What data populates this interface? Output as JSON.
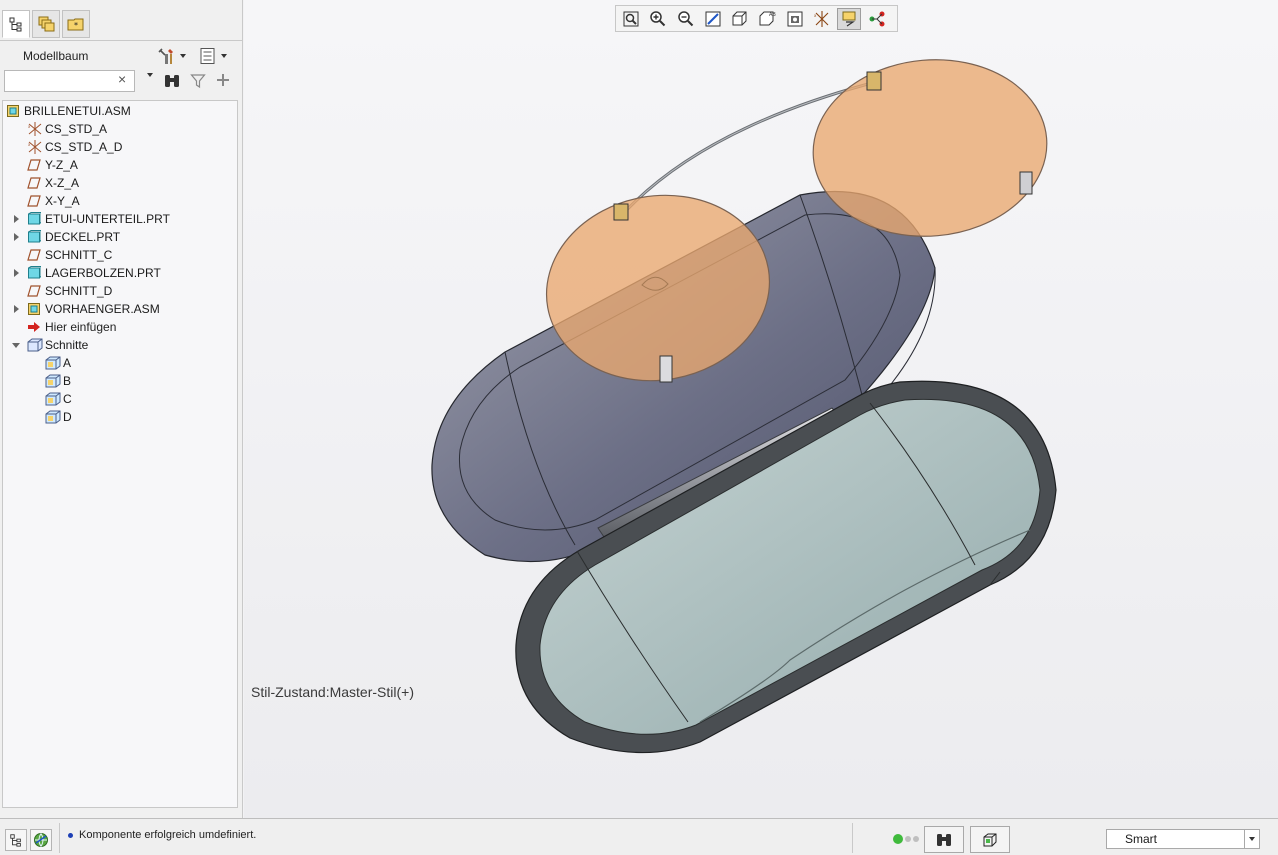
{
  "left_panel": {
    "tabs": [
      "model-tree-icon",
      "layers-icon",
      "favorites-folder-icon"
    ],
    "tree_title": "Modellbaum",
    "search": {
      "value": "",
      "placeholder": ""
    },
    "tree": [
      {
        "label": "BRILLENETUI.ASM",
        "icon": "assembly-icon",
        "depth": 0,
        "expand": "none"
      },
      {
        "label": "CS_STD_A",
        "icon": "coordinate-system-icon",
        "depth": 1,
        "expand": "none"
      },
      {
        "label": "CS_STD_A_D",
        "icon": "coordinate-system-icon",
        "depth": 1,
        "expand": "none"
      },
      {
        "label": "Y-Z_A",
        "icon": "datum-plane-icon",
        "depth": 1,
        "expand": "none"
      },
      {
        "label": "X-Z_A",
        "icon": "datum-plane-icon",
        "depth": 1,
        "expand": "none"
      },
      {
        "label": "X-Y_A",
        "icon": "datum-plane-icon",
        "depth": 1,
        "expand": "none"
      },
      {
        "label": "ETUI-UNTERTEIL.PRT",
        "icon": "part-icon",
        "depth": 1,
        "expand": "collapsed"
      },
      {
        "label": "DECKEL.PRT",
        "icon": "part-icon",
        "depth": 1,
        "expand": "collapsed"
      },
      {
        "label": "SCHNITT_C",
        "icon": "datum-plane-icon",
        "depth": 1,
        "expand": "none"
      },
      {
        "label": "LAGERBOLZEN.PRT",
        "icon": "part-icon",
        "depth": 1,
        "expand": "collapsed"
      },
      {
        "label": "SCHNITT_D",
        "icon": "datum-plane-icon",
        "depth": 1,
        "expand": "none"
      },
      {
        "label": "VORHAENGER.ASM",
        "icon": "assembly-icon",
        "depth": 1,
        "expand": "collapsed"
      },
      {
        "label": "Hier einfügen",
        "icon": "insert-here-arrow-icon",
        "depth": 1,
        "expand": "none"
      },
      {
        "label": "Schnitte",
        "icon": "sections-folder-icon",
        "depth": 1,
        "expand": "expanded"
      },
      {
        "label": "A",
        "icon": "section-icon",
        "depth": 2,
        "expand": "none"
      },
      {
        "label": "B",
        "icon": "section-icon",
        "depth": 2,
        "expand": "none"
      },
      {
        "label": "C",
        "icon": "section-icon",
        "depth": 2,
        "expand": "none"
      },
      {
        "label": "D",
        "icon": "section-icon",
        "depth": 2,
        "expand": "none"
      }
    ]
  },
  "graphics": {
    "toolbar": [
      "refit-icon",
      "zoom-in-icon",
      "zoom-out-icon",
      "repaint-icon",
      "display-style-icon",
      "saved-orientations-icon",
      "view-manager-icon",
      "datum-display-filters-icon",
      "annotation-display-icon",
      "spin-center-icon"
    ],
    "style_state": "Stil-Zustand:Master-Stil(+)"
  },
  "status_bar": {
    "message": "Komponente erfolgreich umdefiniert.",
    "filter": {
      "selected": "Smart"
    },
    "colors": {
      "lens": "#e9a870",
      "lid": "#6c7088",
      "base_inner": "#a7bcbc",
      "base_rim": "#44484c"
    }
  }
}
